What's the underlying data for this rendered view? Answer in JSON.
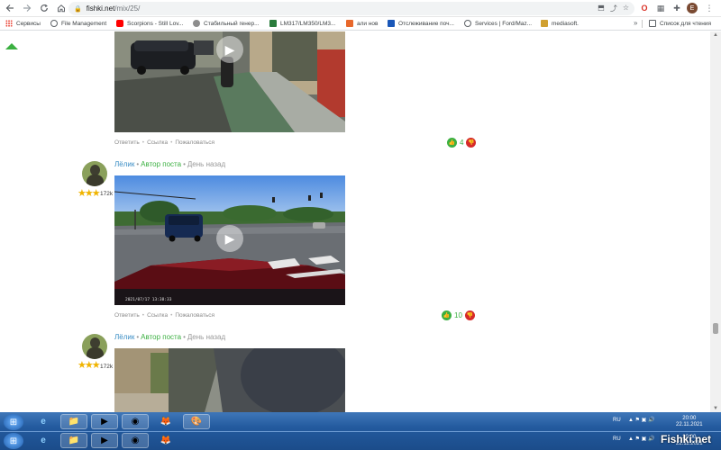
{
  "browser": {
    "url_domain": "fishki.net",
    "url_path": "/mix/25/",
    "back_icon": "arrow-left",
    "forward_icon": "arrow-right",
    "reload_icon": "reload",
    "home_icon": "home",
    "avatar_letter": "E"
  },
  "bookmarks": {
    "items": [
      {
        "label": "Сервисы",
        "color": "#4285f4"
      },
      {
        "label": "File Management",
        "color": "#5f6368"
      },
      {
        "label": "Scorpions - Still Lov...",
        "color": "#ff0000"
      },
      {
        "label": "Стабильный генер...",
        "color": "#5f6368"
      },
      {
        "label": "LM317/LM350/LM3...",
        "color": "#2a7c3c"
      },
      {
        "label": "али нов",
        "color": "#e8682b"
      },
      {
        "label": "Отслеживание поч...",
        "color": "#1a57b8"
      },
      {
        "label": "Services | Ford/Maz...",
        "color": "#5f6368"
      },
      {
        "label": "mediasoft.",
        "color": "#d0a030"
      }
    ],
    "overflow": "»",
    "reading_list": "Список для чтения"
  },
  "post1": {
    "actions": [
      "Ответить",
      "Ссылка",
      "Пожаловаться"
    ],
    "votes": "4"
  },
  "comment2": {
    "user": "Лёлик",
    "badge": "Автор поста",
    "time": "День назад",
    "karma": "172k",
    "actions": [
      "Ответить",
      "Ссылка",
      "Пожаловаться"
    ],
    "votes": "10",
    "video_timestamp": "2021/07/17  13:38:33"
  },
  "comment3": {
    "user": "Лёлик",
    "badge": "Автор поста",
    "time": "День назад",
    "karma": "172k"
  },
  "taskbar": {
    "lang": "RU",
    "time": "20:00",
    "date": "22.11.2021",
    "lang2": "RU",
    "time2": "20:00",
    "date2": "22.11.2021"
  },
  "watermark": "Fishki.net"
}
